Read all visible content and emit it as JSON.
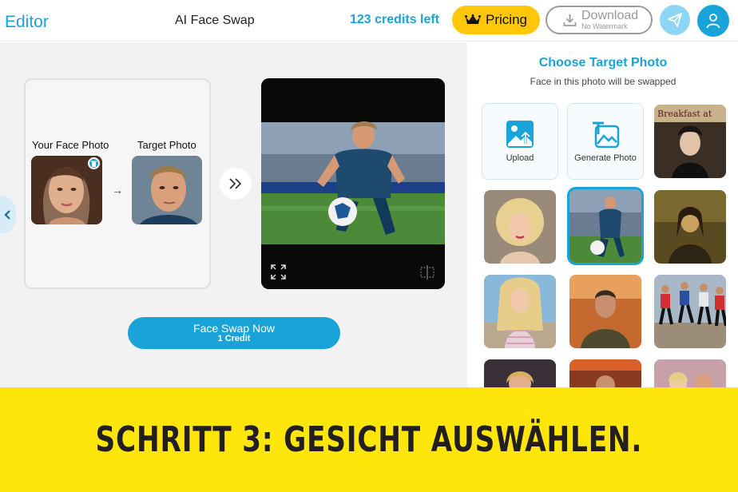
{
  "header": {
    "editor_label": "Editor",
    "app_title": "AI Face Swap",
    "credits_text": "123 credits left",
    "pricing_label": "Pricing",
    "download_label": "Download",
    "download_sub": "No Watermark"
  },
  "editor": {
    "your_face_label": "Your Face Photo",
    "target_label": "Target Photo",
    "swap_button_label": "Face Swap Now",
    "swap_button_sub": "1 Credit"
  },
  "panel": {
    "title": "Choose Target Photo",
    "subtitle": "Face in this photo will be swapped",
    "upload_label": "Upload",
    "generate_label": "Generate Photo",
    "tile_sign_text": "Breakfast at"
  },
  "banner": {
    "text": "SCHRITT 3: GESICHT AUSWÄHLEN."
  },
  "colors": {
    "accent": "#1aa3d8",
    "pricing": "#ffc60a",
    "banner": "#ffe60a",
    "selected_border": "#1aa3d8"
  },
  "icons": [
    "crown-icon",
    "download-icon",
    "send-icon",
    "user-icon",
    "chevron-left-icon",
    "delete-icon",
    "arrow-right-icon",
    "double-chevron-right-icon",
    "expand-icon",
    "compare-icon",
    "image-upload-icon",
    "generate-photo-icon"
  ]
}
